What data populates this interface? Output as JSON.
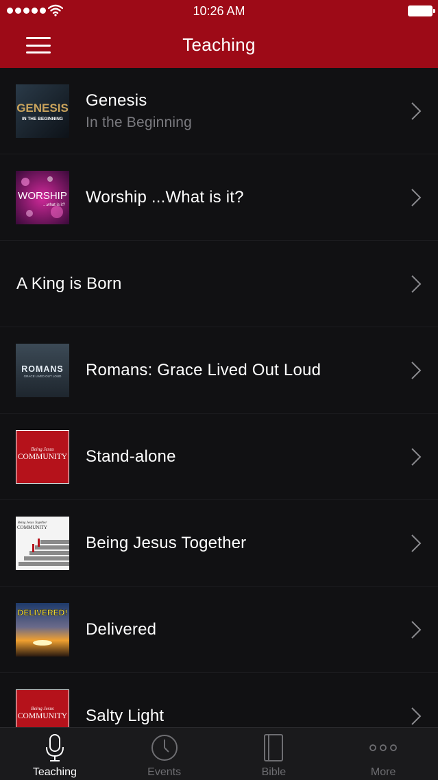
{
  "status_bar": {
    "time": "10:26 AM"
  },
  "header": {
    "title": "Teaching"
  },
  "items": [
    {
      "title": "Genesis",
      "subtitle": "In the Beginning",
      "thumb_text": "GENESIS",
      "thumb_sub": "IN THE BEGINNING"
    },
    {
      "title": "Worship ...What is it?",
      "thumb_text": "WORSHIP",
      "thumb_sub": "...what is it?"
    },
    {
      "title": "A King is Born"
    },
    {
      "title": "Romans: Grace Lived Out Loud",
      "thumb_text": "ROMANS",
      "thumb_sub": "GRACE LIVED OUT LOUD"
    },
    {
      "title": "Stand-alone",
      "thumb_text": "COMMUNITY",
      "thumb_sub": "Being Jesus"
    },
    {
      "title": "Being Jesus Together",
      "thumb_text": "COMMUNITY",
      "thumb_sub": "Being Jesus Together"
    },
    {
      "title": "Delivered",
      "thumb_text": "DELIVERED!"
    },
    {
      "title": "Salty Light",
      "thumb_text": "COMMUNITY",
      "thumb_sub": "Being Jesus"
    }
  ],
  "tabs": [
    {
      "label": "Teaching",
      "icon": "microphone-icon",
      "active": true
    },
    {
      "label": "Events",
      "icon": "clock-icon"
    },
    {
      "label": "Bible",
      "icon": "book-icon"
    },
    {
      "label": "More",
      "icon": "more-dots-icon"
    }
  ],
  "colors": {
    "brand": "#9d0a17",
    "background": "#111113",
    "subtitle": "#7a7a7f"
  }
}
